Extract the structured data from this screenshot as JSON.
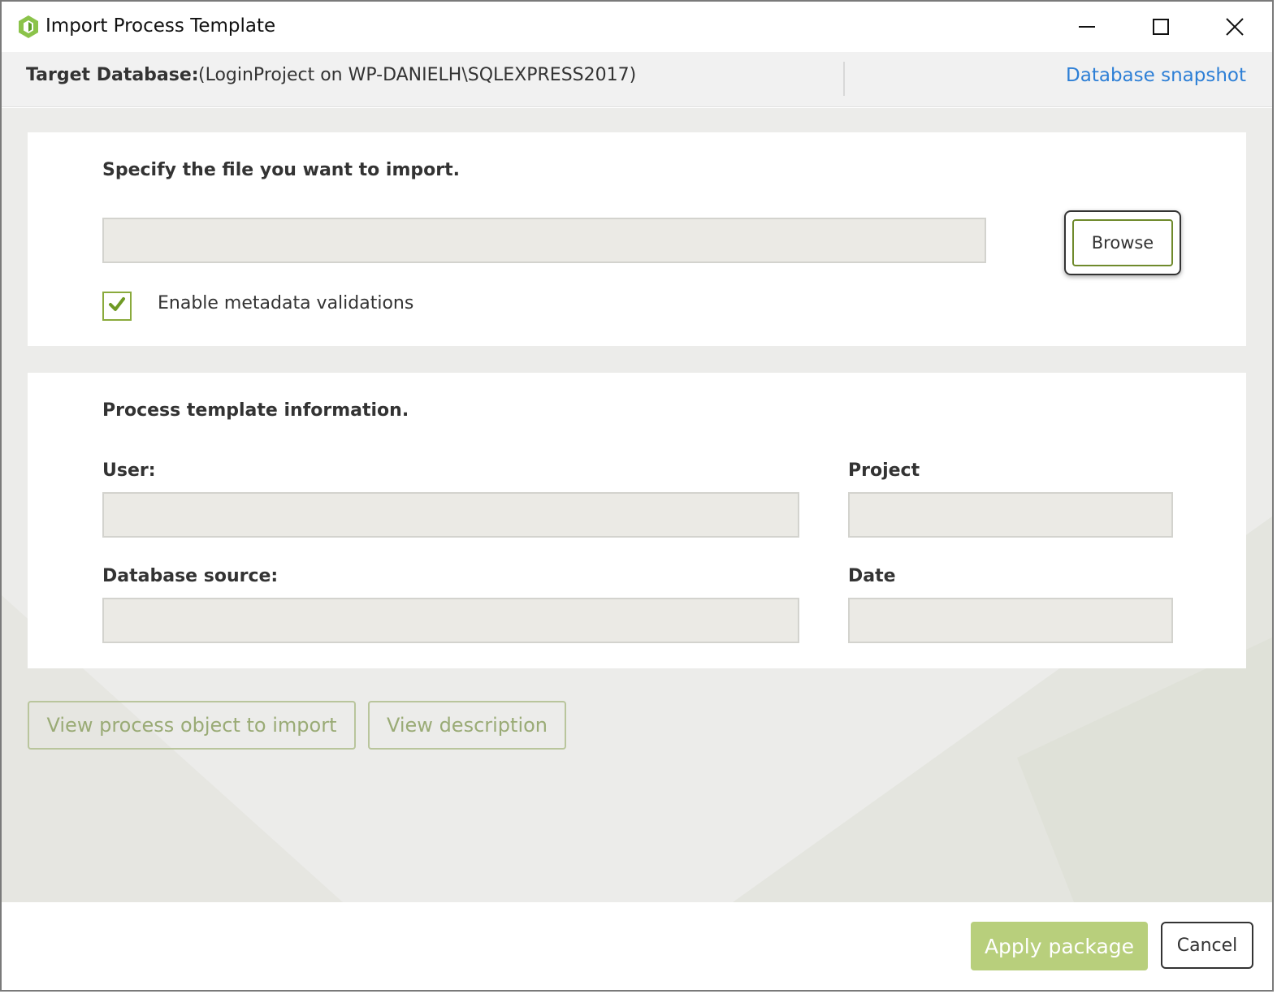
{
  "window": {
    "title": "Import Process Template",
    "icon": "app-hexagon-icon",
    "controls": [
      "minimize-icon",
      "maximize-icon",
      "close-icon"
    ]
  },
  "header": {
    "target_label": "Target Database:",
    "target_value": "(LoginProject on WP-DANIELH\\SQLEXPRESS2017)",
    "snapshot_link": "Database snapshot"
  },
  "file_section": {
    "heading": "Specify the file you want to import.",
    "file_path_value": "",
    "browse_label": "Browse",
    "validation_checkbox": {
      "label": "Enable metadata validations",
      "checked": true
    }
  },
  "info_section": {
    "heading": "Process template information.",
    "user_label": "User:",
    "user_value": "",
    "project_label": "Project",
    "project_value": "",
    "db_source_label": "Database source:",
    "db_source_value": "",
    "date_label": "Date",
    "date_value": ""
  },
  "actions": {
    "view_objects_label": "View process object to import",
    "view_description_label": "View description"
  },
  "footer": {
    "apply_label": "Apply package",
    "cancel_label": "Cancel"
  },
  "colors": {
    "accent_green": "#8aaa3c",
    "apply_disabled": "#b8cf7c",
    "link_blue": "#2d7fd6"
  }
}
